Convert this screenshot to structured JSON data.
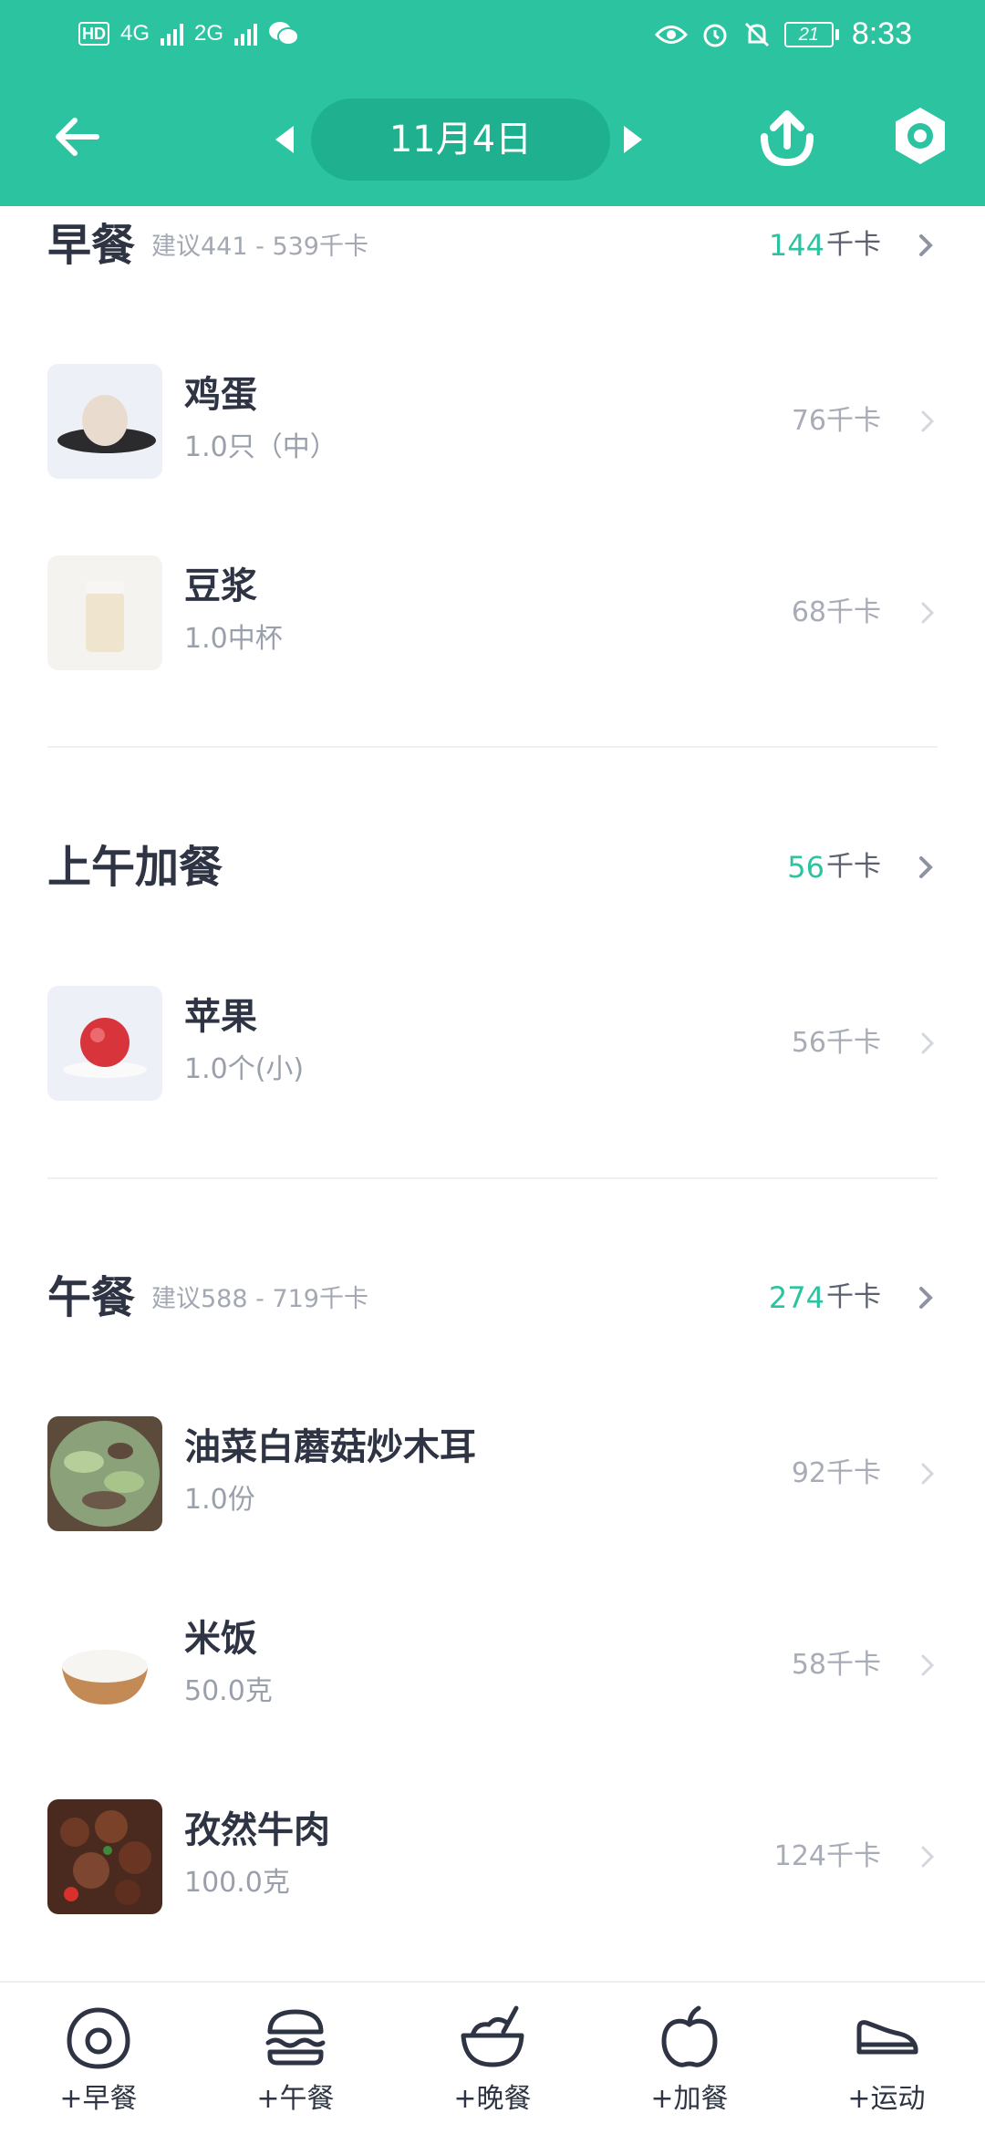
{
  "status_bar": {
    "hd": "HD",
    "net1": "4G",
    "net2": "2G",
    "battery": "21",
    "time": "8:33"
  },
  "header": {
    "date": "11月4日"
  },
  "sections": {
    "breakfast": {
      "title": "早餐",
      "hint": "建议441 - 539千卡",
      "kcal": "144",
      "unit": "千卡",
      "items": [
        {
          "name": "鸡蛋",
          "portion": "1.0只（中）",
          "cal": "76千卡"
        },
        {
          "name": "豆浆",
          "portion": "1.0中杯",
          "cal": "68千卡"
        }
      ]
    },
    "morning_snack": {
      "title": "上午加餐",
      "kcal": "56",
      "unit": "千卡",
      "items": [
        {
          "name": "苹果",
          "portion": "1.0个(小)",
          "cal": "56千卡"
        }
      ]
    },
    "lunch": {
      "title": "午餐",
      "hint": "建议588 - 719千卡",
      "kcal": "274",
      "unit": "千卡",
      "items": [
        {
          "name": "油菜白蘑菇炒木耳",
          "portion": "1.0份",
          "cal": "92千卡"
        },
        {
          "name": "米饭",
          "portion": "50.0克",
          "cal": "58千卡"
        },
        {
          "name": "孜然牛肉",
          "portion": "100.0克",
          "cal": "124千卡"
        }
      ]
    }
  },
  "bottom_tabs": [
    {
      "label": "+早餐",
      "icon": "egg-icon"
    },
    {
      "label": "+午餐",
      "icon": "burger-icon"
    },
    {
      "label": "+晚餐",
      "icon": "bowl-icon"
    },
    {
      "label": "+加餐",
      "icon": "apple-icon"
    },
    {
      "label": "+运动",
      "icon": "shoe-icon"
    }
  ],
  "colors": {
    "accent": "#2bc3a0",
    "accent_dark": "#1fb08f",
    "text": "#2e3443",
    "muted": "#a3a8b3"
  }
}
